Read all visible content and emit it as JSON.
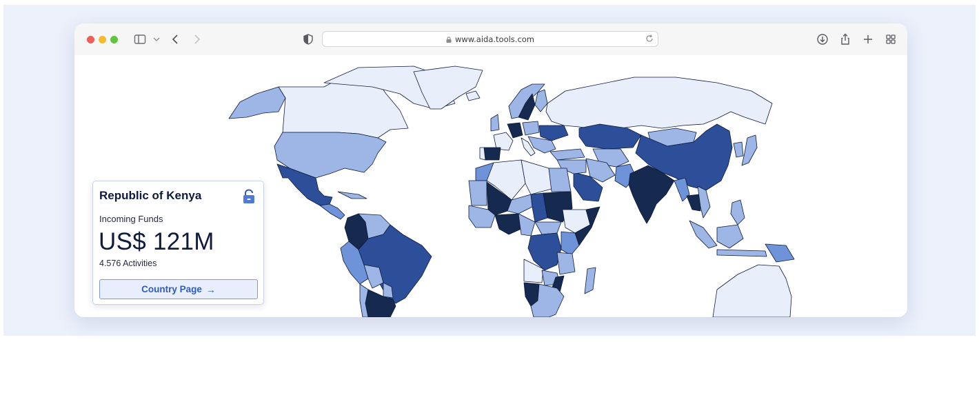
{
  "browser": {
    "url": "www.aida.tools.com",
    "traffic_lights": [
      "#ec5f57",
      "#f4bd30",
      "#5fc53b"
    ],
    "icons": [
      "sidebar-icon",
      "chevron-down-icon",
      "back-icon",
      "forward-icon",
      "shield-icon",
      "lock-icon",
      "reload-icon",
      "download-icon",
      "share-icon",
      "new-tab-icon",
      "tab-overview-icon"
    ]
  },
  "map": {
    "palette": {
      "very_low": "#e8eefa",
      "low": "#9db6e6",
      "medium": "#6f93d8",
      "high": "#2d4f9a",
      "very_high": "#16294f"
    }
  },
  "card": {
    "country": "Republic of Kenya",
    "label": "Incoming Funds",
    "amount": "US$ 121M",
    "activities": "4.576 Activities",
    "button_label": "Country Page",
    "button_arrow": "→",
    "lock_icon": "unlocked-padlock-icon",
    "accent": "#2d5bbe"
  }
}
